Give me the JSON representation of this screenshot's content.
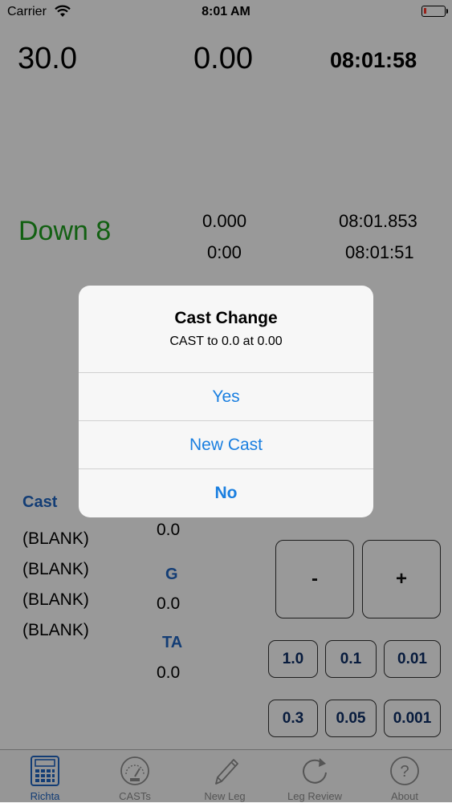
{
  "status": {
    "carrier": "Carrier",
    "time": "8:01 AM"
  },
  "top": {
    "speed": "30.0",
    "distance": "0.00",
    "clock": "08:01:58"
  },
  "info": {
    "status_text": "Down 8",
    "value1": "0.000",
    "value2": "0:00",
    "time1": "08:01.853",
    "time2": "08:01:51"
  },
  "cast": {
    "label": "Cast",
    "items": [
      "(BLANK)",
      "(BLANK)",
      "(BLANK)",
      "(BLANK)"
    ]
  },
  "g_panel": {
    "value_top": "0.0",
    "g_label": "G",
    "g_value": "0.0",
    "ta_label": "TA",
    "ta_value": "0.0"
  },
  "stepper": {
    "minus": "-",
    "plus": "+"
  },
  "increments": [
    "1.0",
    "0.1",
    "0.01",
    "0.3",
    "0.05",
    "0.001"
  ],
  "tabs": [
    {
      "label": "Richta",
      "icon": "calculator-icon"
    },
    {
      "label": "CASTs",
      "icon": "speedometer-icon"
    },
    {
      "label": "New Leg",
      "icon": "pencil-icon"
    },
    {
      "label": "Leg Review",
      "icon": "replay-icon"
    },
    {
      "label": "About",
      "icon": "question-icon"
    }
  ],
  "alert": {
    "title": "Cast Change",
    "message": "CAST to 0.0 at 0.00",
    "actions": {
      "yes": "Yes",
      "new_cast": "New Cast",
      "no": "No"
    }
  },
  "colors": {
    "accent": "#1a7fe0",
    "green": "#1fa11f",
    "label_blue": "#2166c4"
  }
}
